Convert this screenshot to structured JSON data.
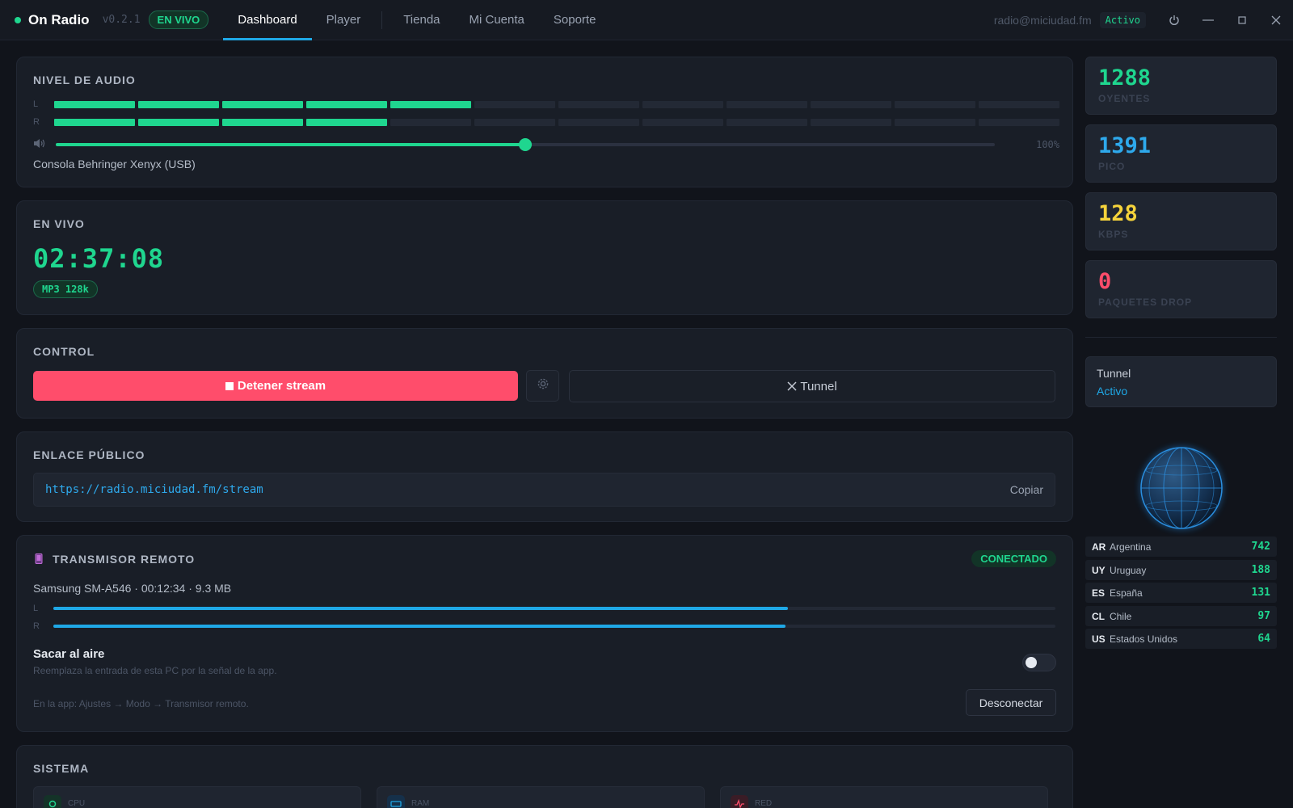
{
  "app": {
    "name": "On Radio",
    "version": "v0.2.1",
    "live_badge": "EN VIVO"
  },
  "nav": {
    "tabs": [
      "Dashboard",
      "Player",
      "Tienda",
      "Mi Cuenta",
      "Soporte"
    ],
    "active": "Dashboard"
  },
  "account": {
    "email": "radio@miciudad.fm",
    "status": "Activo"
  },
  "window_controls": [
    "power-icon",
    "minimize-icon",
    "maximize-icon",
    "close-icon"
  ],
  "audio": {
    "title": "NIVEL DE AUDIO",
    "channels": [
      {
        "label": "L",
        "segments_on": 5,
        "segments_total": 12
      },
      {
        "label": "R",
        "segments_on": 4,
        "segments_total": 12
      }
    ],
    "volume_level": 0.5,
    "volume_label": "100%",
    "device": "Consola Behringer Xenyx (USB)"
  },
  "live": {
    "title": "EN VIVO",
    "time": "02:37:08",
    "codec": "MP3 128k"
  },
  "control": {
    "title": "CONTROL",
    "stop_label": "Detener stream",
    "tunnel_label": "Tunnel"
  },
  "public_link": {
    "title": "ENLACE PÚBLICO",
    "url": "https://radio.miciudad.fm/stream",
    "copy_label": "Copiar"
  },
  "remote": {
    "title": "TRANSMISOR REMOTO",
    "status": "CONECTADO",
    "device_info": "Samsung SM-A546 · 00:12:34 · 9.3 MB",
    "levels": [
      {
        "label": "L",
        "level": 0.733
      },
      {
        "label": "R",
        "level": 0.731
      }
    ],
    "air_title": "Sacar al aire",
    "air_desc": "Reemplaza la entrada de esta PC por la señal de la app.",
    "air_enabled": false,
    "hint": "En la app: Ajustes → Modo → Transmisor remoto.",
    "disconnect_label": "Desconectar"
  },
  "system": {
    "title": "SISTEMA",
    "tiles": [
      {
        "label": "CPU",
        "icon": "cpu-icon",
        "color": "#1fd68f"
      },
      {
        "label": "RAM",
        "icon": "ram-icon",
        "color": "#1fa8e6"
      },
      {
        "label": "RED",
        "icon": "network-icon",
        "color": "#ff4d6b"
      }
    ]
  },
  "stats": [
    {
      "value": "1288",
      "label": "OYENTES",
      "color": "#1fd68f"
    },
    {
      "value": "1391",
      "label": "PICO",
      "color": "#2ea9ec"
    },
    {
      "value": "128",
      "label": "KBPS",
      "color": "#f5d33b"
    },
    {
      "value": "0",
      "label": "PAQUETES DROP",
      "color": "#ff4d6b"
    }
  ],
  "tunnel": {
    "label": "Tunnel",
    "value": "Activo"
  },
  "countries": [
    {
      "code": "AR",
      "name": "Argentina",
      "count": "742"
    },
    {
      "code": "UY",
      "name": "Uruguay",
      "count": "188"
    },
    {
      "code": "ES",
      "name": "España",
      "count": "131"
    },
    {
      "code": "CL",
      "name": "Chile",
      "count": "97"
    },
    {
      "code": "US",
      "name": "Estados Unidos",
      "count": "64"
    }
  ],
  "colors": {
    "accent_green": "#1fd68f",
    "accent_blue": "#1fa8e6",
    "danger": "#ff4d6b"
  }
}
